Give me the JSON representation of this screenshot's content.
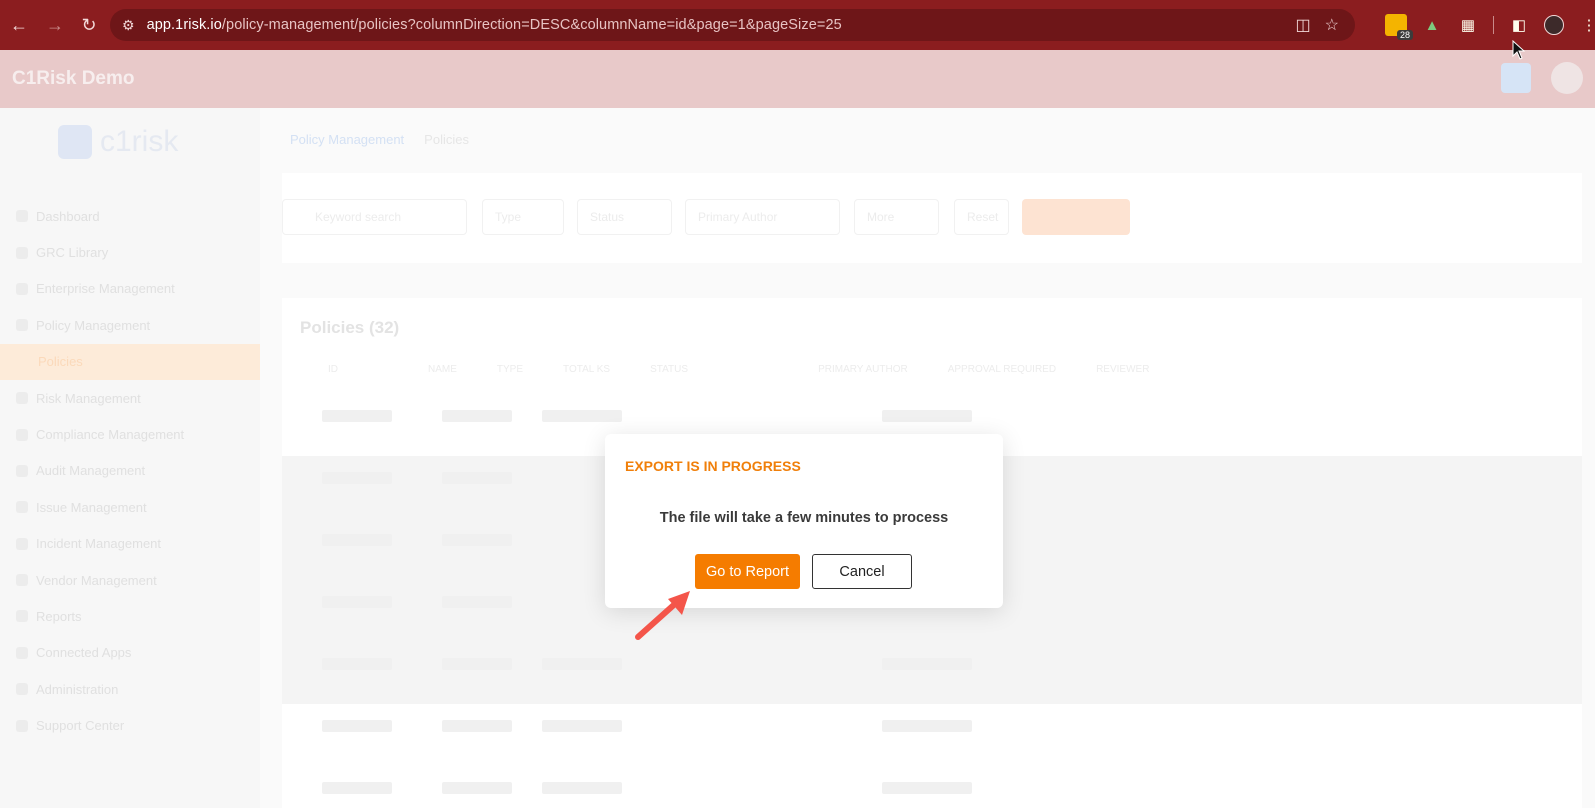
{
  "browser": {
    "url_host": "app.1risk.io",
    "url_path": "/policy-management/policies?columnDirection=DESC&columnName=id&page=1&pageSize=25",
    "extension_badge": "28"
  },
  "app": {
    "title": "C1Risk Demo",
    "logo_text": "c1risk",
    "breadcrumb": [
      "Policy Management",
      "Policies"
    ],
    "sidebar": [
      "Dashboard",
      "GRC Library",
      "Enterprise Management",
      "Policy Management",
      "Policies",
      "Risk Management",
      "Compliance Management",
      "Audit Management",
      "Issue Management",
      "Incident Management",
      "Vendor Management",
      "Reports",
      "Connected Apps",
      "Administration",
      "Support Center"
    ],
    "filters": {
      "search_placeholder": "Keyword search",
      "type": "Type",
      "status": "Status",
      "primary_author": "Primary Author",
      "more": "More",
      "reset": "Reset"
    },
    "table": {
      "title": "Policies (32)",
      "columns": [
        "ID",
        "NAME",
        "TYPE",
        "TOTAL KS",
        "STATUS",
        "PRIMARY AUTHOR",
        "APPROVAL REQUIRED",
        "REVIEWER"
      ]
    }
  },
  "modal": {
    "title": "EXPORT IS IN PROGRESS",
    "message": "The file will take a few minutes to process",
    "primary_button": "Go to Report",
    "secondary_button": "Cancel"
  },
  "colors": {
    "browser_bar": "#8b1d1f",
    "accent": "#f57c00"
  }
}
